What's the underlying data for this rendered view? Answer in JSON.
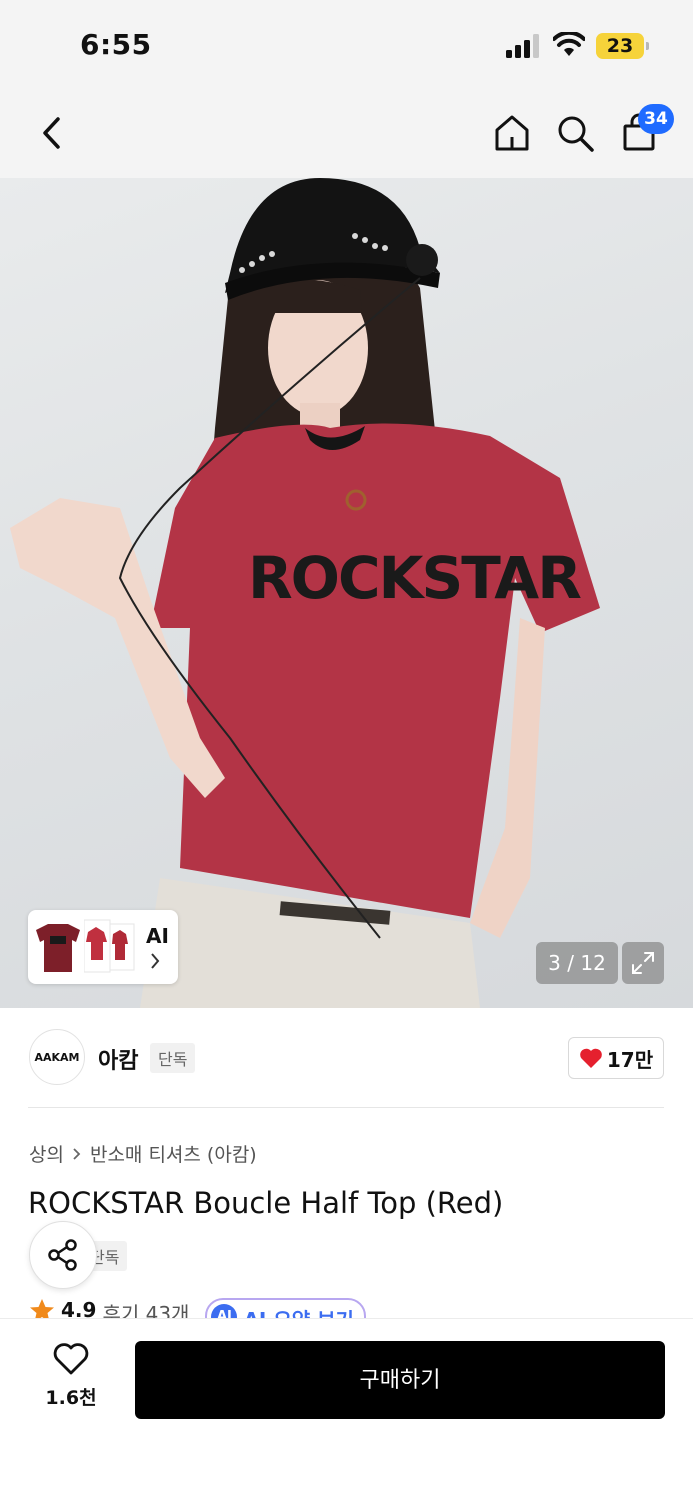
{
  "status_bar": {
    "time": "6:55",
    "battery": "23"
  },
  "nav": {
    "back_icon": "chevron-left-icon",
    "home_icon": "home-icon",
    "search_icon": "search-icon",
    "cart_icon": "shopping-bag-icon",
    "cart_count": "34"
  },
  "gallery": {
    "shirt_text": "ROCKSTAR",
    "thumb_label": "AI",
    "counter": "3 / 12",
    "expand_icon": "expand-icon"
  },
  "brand": {
    "logo_text": "AAKAM",
    "name": "아캄",
    "tag": "단독",
    "likes": "17만"
  },
  "product": {
    "breadcrumb": [
      "상의",
      "반소매 티셔츠 (아캄)"
    ],
    "title": "ROCKSTAR Boucle Half Top (Red)",
    "exclusive_tag": "단독",
    "rating": "4.9",
    "reviews": "후기 43개",
    "ai_badge": "AI",
    "ai_summary": "AI 요약 보기"
  },
  "bottom_bar": {
    "wish_count": "1.6천",
    "buy_label": "구매하기"
  },
  "colors": {
    "accent_blue": "#1f6bff",
    "heart_red": "#e5202e",
    "shirt_red": "#b33446",
    "buy_button": "#000000"
  }
}
